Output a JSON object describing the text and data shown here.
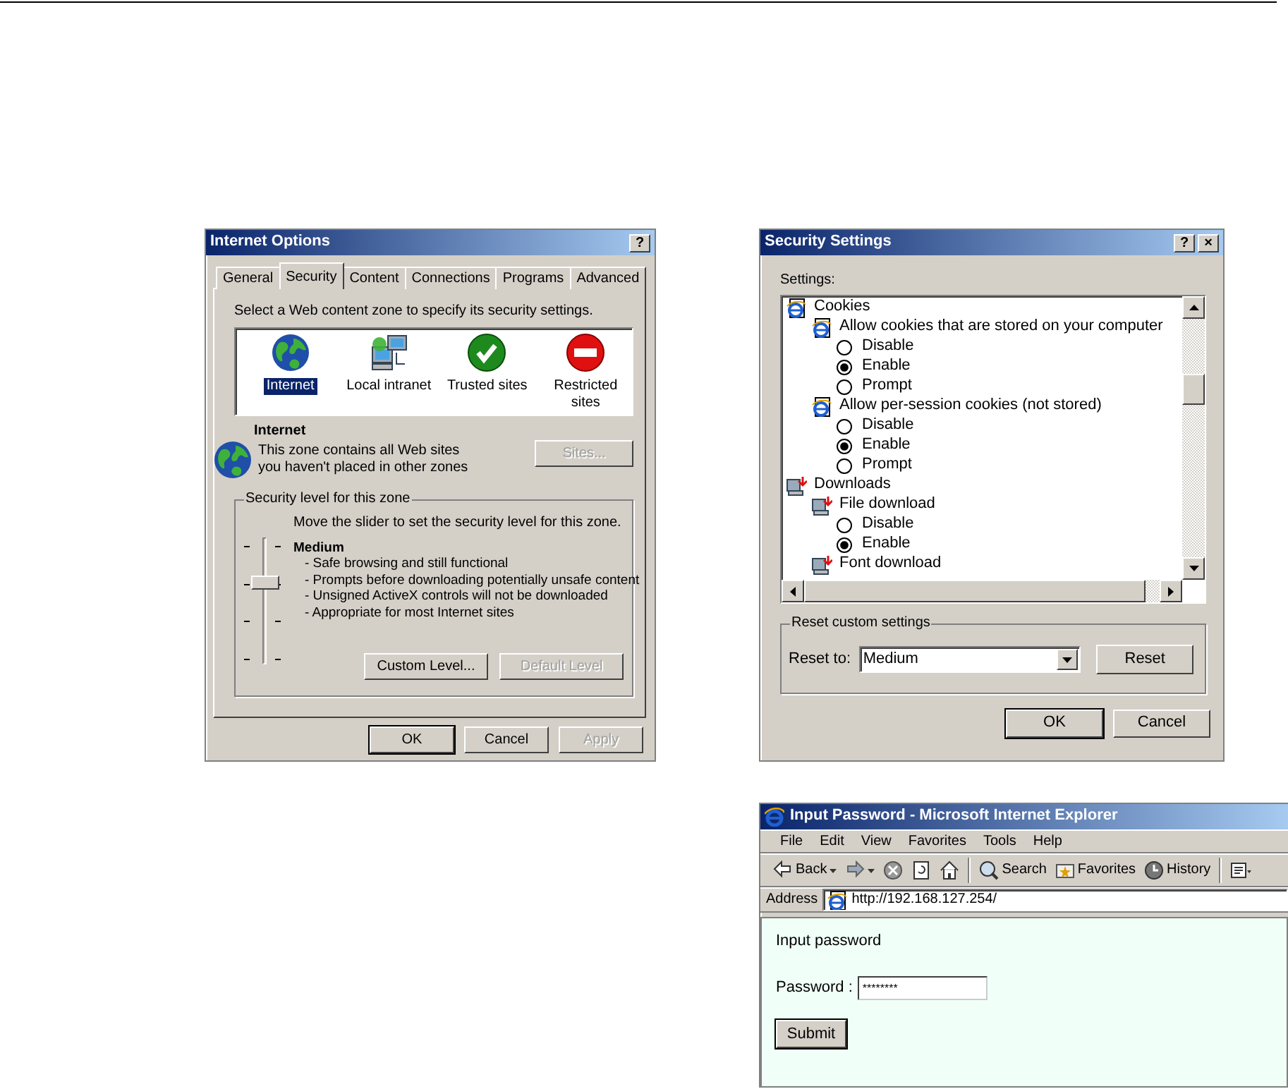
{
  "internet_options": {
    "title": "Internet Options",
    "title_buttons": [
      "?"
    ],
    "tabs": [
      {
        "label": "General",
        "selected": false
      },
      {
        "label": "Security",
        "selected": true
      },
      {
        "label": "Content",
        "selected": false
      },
      {
        "label": "Connections",
        "selected": false
      },
      {
        "label": "Programs",
        "selected": false
      },
      {
        "label": "Advanced",
        "selected": false
      }
    ],
    "zone_prompt": "Select a Web content zone to specify its security settings.",
    "zones": [
      {
        "label": "Internet",
        "kind": "globe",
        "selected": true
      },
      {
        "label": "Local intranet",
        "kind": "network",
        "selected": false
      },
      {
        "label": "Trusted sites",
        "kind": "check",
        "selected": false
      },
      {
        "label": "Restricted sites",
        "kind": "stop",
        "selected": false
      }
    ],
    "zone_name": "Internet",
    "zone_description": "This zone contains all Web sites you haven't placed in other zones",
    "sites_button": {
      "label": "Sites...",
      "disabled": true
    },
    "level_group": "Security level for this zone",
    "slider_hint": "Move the slider to set the security level for this zone.",
    "slider": {
      "level": 0.67
    },
    "level_name": "Medium",
    "level_points": [
      "- Safe browsing and still functional",
      "- Prompts before downloading potentially unsafe content",
      "- Unsigned ActiveX controls will not be downloaded",
      "- Appropriate for most Internet sites"
    ],
    "level_buttons": [
      {
        "label": "Custom Level...",
        "disabled": false
      },
      {
        "label": "Default Level",
        "disabled": true
      }
    ],
    "footer_buttons": [
      {
        "label": "OK",
        "disabled": false,
        "default": true
      },
      {
        "label": "Cancel",
        "disabled": false,
        "default": false
      },
      {
        "label": "Apply",
        "disabled": true,
        "default": false
      }
    ]
  },
  "security_settings": {
    "title": "Security Settings",
    "title_buttons": [
      "?",
      "×"
    ],
    "settings_label": "Settings:",
    "tree": [
      {
        "label": "Cookies",
        "kind": "category",
        "children": [
          {
            "label": "Allow cookies that are stored on your computer",
            "kind": "setting",
            "children": [
              {
                "label": "Disable",
                "kind": "option",
                "selected": false
              },
              {
                "label": "Enable",
                "kind": "option",
                "selected": true
              },
              {
                "label": "Prompt",
                "kind": "option",
                "selected": false
              }
            ]
          },
          {
            "label": "Allow per-session cookies (not stored)",
            "kind": "setting",
            "children": [
              {
                "label": "Disable",
                "kind": "option",
                "selected": false
              },
              {
                "label": "Enable",
                "kind": "option",
                "selected": true
              },
              {
                "label": "Prompt",
                "kind": "option",
                "selected": false
              }
            ]
          }
        ]
      },
      {
        "label": "Downloads",
        "kind": "category",
        "children": [
          {
            "label": "File download",
            "kind": "setting",
            "children": [
              {
                "label": "Disable",
                "kind": "option",
                "selected": false
              },
              {
                "label": "Enable",
                "kind": "option",
                "selected": true
              }
            ]
          },
          {
            "label": "Font download",
            "kind": "setting"
          }
        ]
      }
    ],
    "reset_group": "Reset custom settings",
    "reset_label": "Reset to:",
    "reset_value": "Medium",
    "reset_button": "Reset",
    "footer_buttons": [
      {
        "label": "OK",
        "disabled": false,
        "default": true
      },
      {
        "label": "Cancel",
        "disabled": false,
        "default": false
      }
    ]
  },
  "browser": {
    "title": "Input Password - Microsoft Internet Explorer",
    "menu": [
      "File",
      "Edit",
      "View",
      "Favorites",
      "Tools",
      "Help"
    ],
    "toolbar": [
      {
        "kind": "back",
        "label": "Back"
      },
      {
        "kind": "forward"
      },
      {
        "kind": "stop"
      },
      {
        "kind": "refresh"
      },
      {
        "kind": "home"
      },
      {
        "kind": "search",
        "label": "Search"
      },
      {
        "kind": "favorites",
        "label": "Favorites"
      },
      {
        "kind": "history",
        "label": "History"
      },
      {
        "kind": "mail"
      }
    ],
    "address_label": "Address",
    "url": "http://192.168.127.254/",
    "page": {
      "heading": "Input password",
      "field_label": "Password :",
      "password": "********",
      "submit": "Submit"
    }
  }
}
